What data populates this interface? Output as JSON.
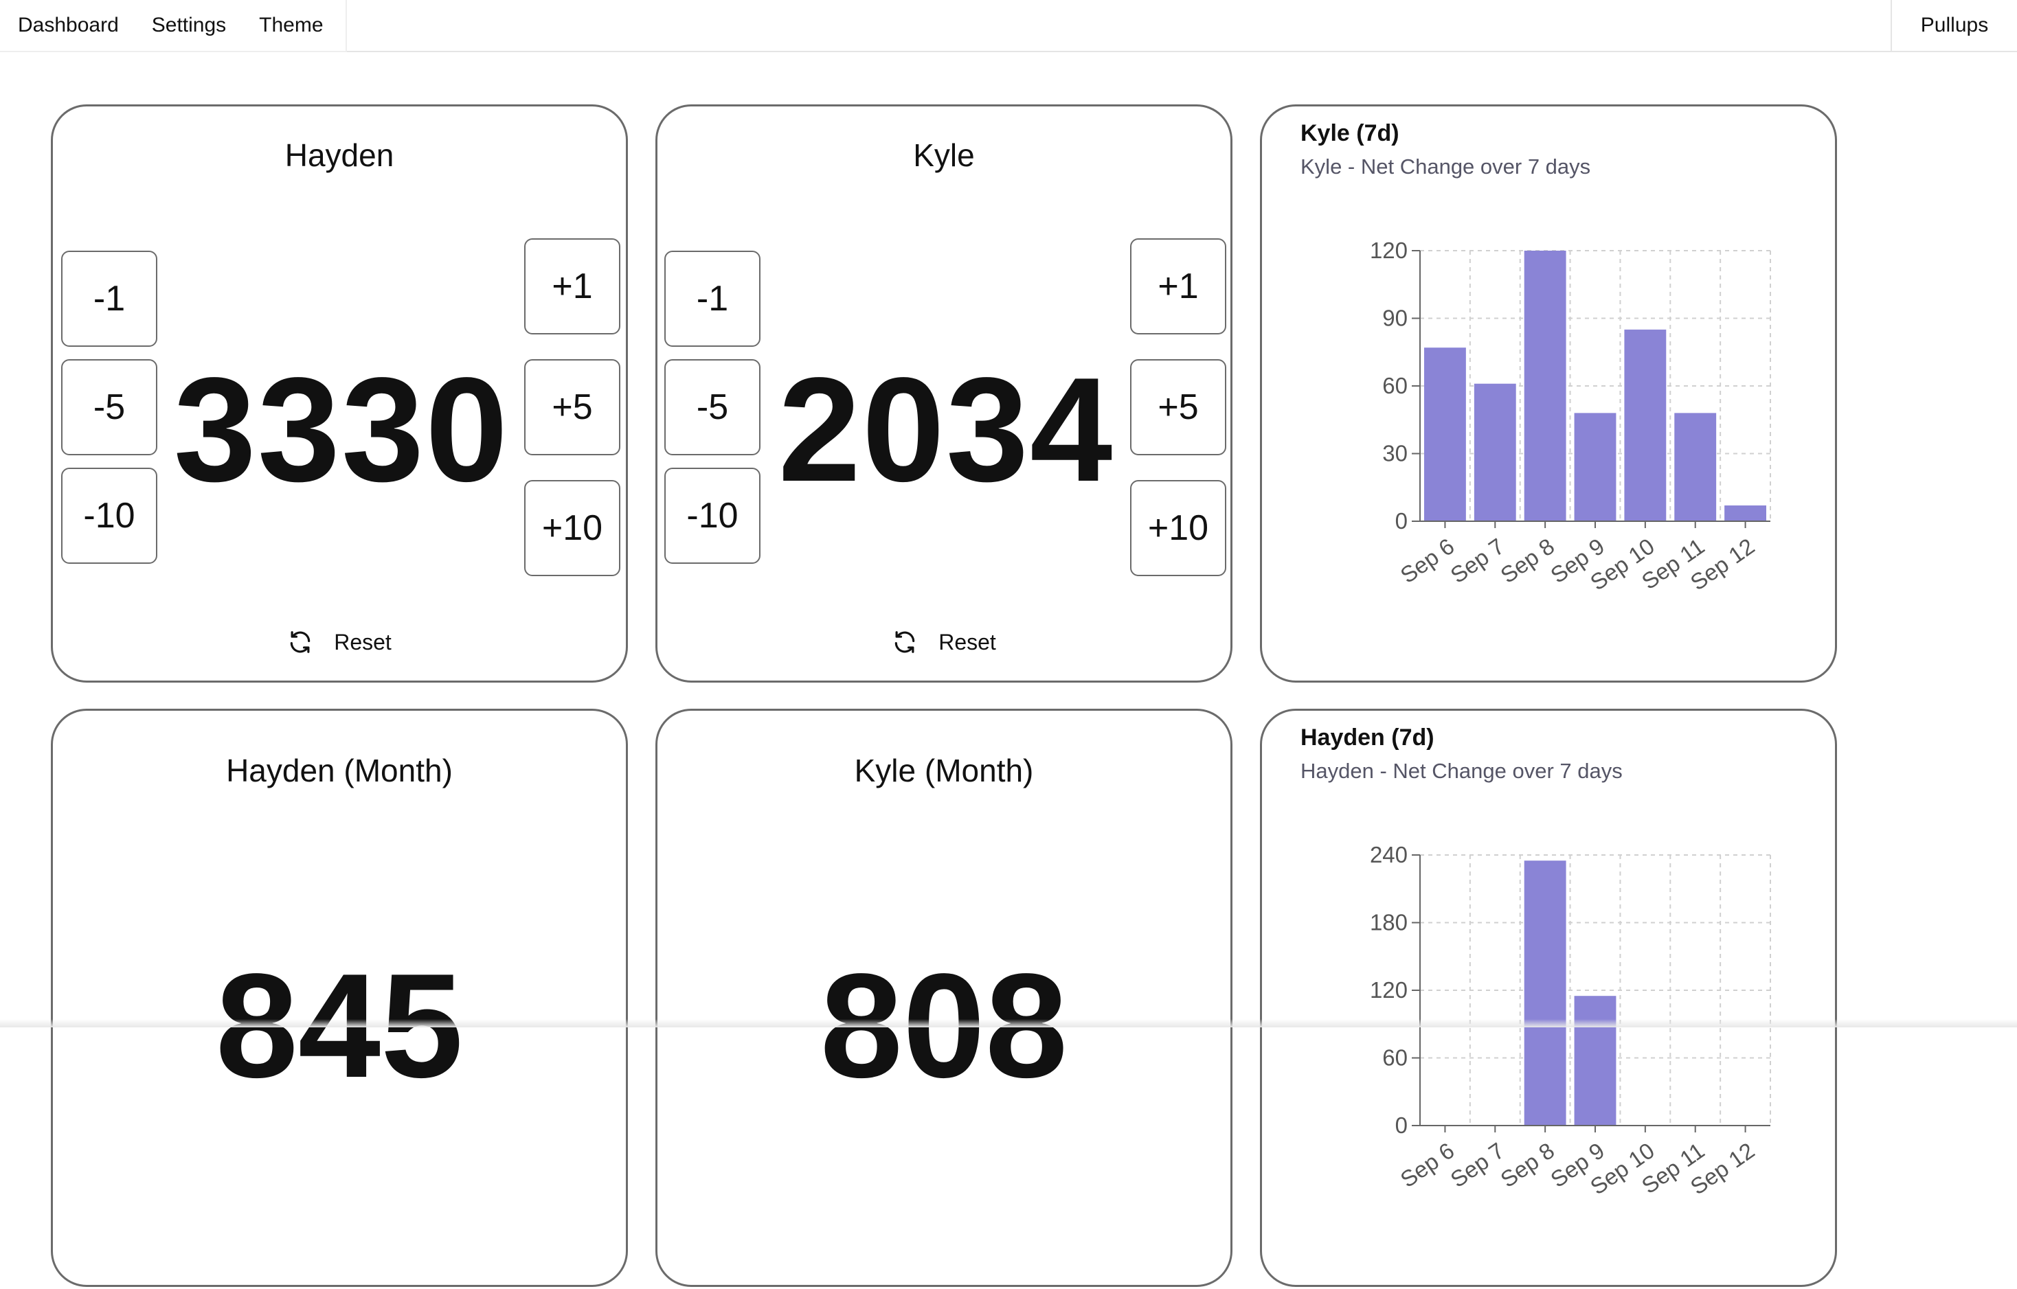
{
  "nav": {
    "items": [
      "Dashboard",
      "Settings",
      "Theme"
    ],
    "app_title": "Pullups"
  },
  "counters": [
    {
      "name": "Hayden",
      "count": "3330",
      "minus": [
        "-1",
        "-5",
        "-10"
      ],
      "plus": [
        "+1",
        "+5",
        "+10"
      ],
      "reset_label": "Reset"
    },
    {
      "name": "Kyle",
      "count": "2034",
      "minus": [
        "-1",
        "-5",
        "-10"
      ],
      "plus": [
        "+1",
        "+5",
        "+10"
      ],
      "reset_label": "Reset"
    }
  ],
  "monthly": [
    {
      "title": "Hayden (Month)",
      "count": "845"
    },
    {
      "title": "Kyle (Month)",
      "count": "808"
    }
  ],
  "colors": {
    "bar": "#8a84d6",
    "card_border": "#6b6b6b",
    "grid": "#d0d0d0"
  },
  "chart_data": [
    {
      "type": "bar",
      "title": "Kyle (7d)",
      "subtitle": "Kyle - Net Change over 7 days",
      "categories": [
        "Sep 6",
        "Sep 7",
        "Sep 8",
        "Sep 9",
        "Sep 10",
        "Sep 11",
        "Sep 12"
      ],
      "values": [
        77,
        61,
        120,
        48,
        85,
        48,
        7
      ],
      "yticks": [
        0,
        30,
        60,
        90,
        120
      ],
      "ylim": [
        0,
        120
      ],
      "grid": true
    },
    {
      "type": "bar",
      "title": "Hayden (7d)",
      "subtitle": "Hayden - Net Change over 7 days",
      "categories": [
        "Sep 6",
        "Sep 7",
        "Sep 8",
        "Sep 9",
        "Sep 10",
        "Sep 11",
        "Sep 12"
      ],
      "values": [
        null,
        null,
        235,
        115,
        null,
        null,
        null
      ],
      "yticks": [
        0,
        60,
        120,
        180,
        240
      ],
      "ylim": [
        0,
        240
      ],
      "grid": true
    }
  ]
}
